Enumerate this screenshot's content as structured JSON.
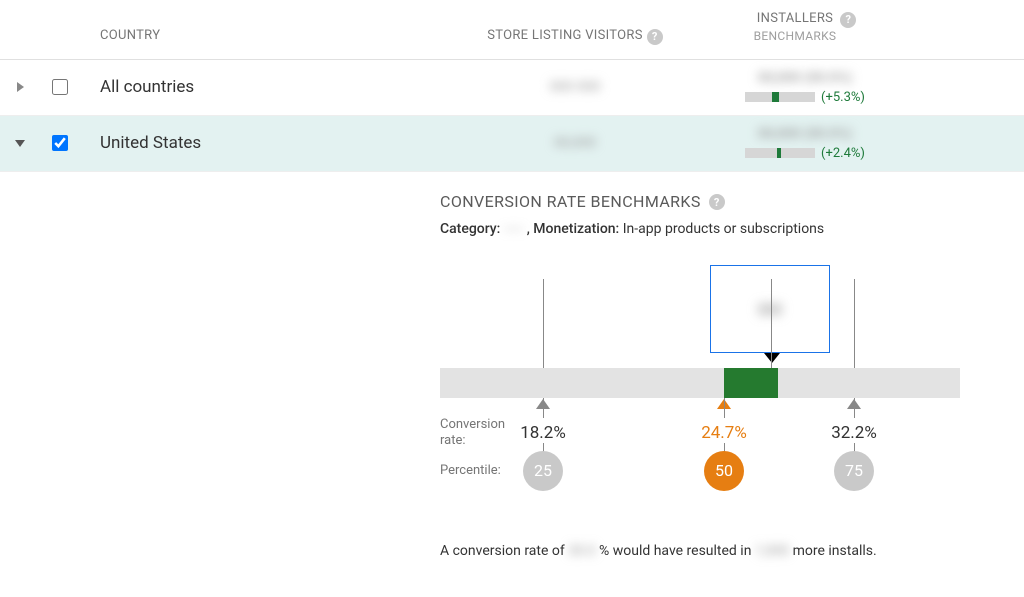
{
  "headers": {
    "country": "COUNTRY",
    "visitors": "STORE LISTING VISITORS",
    "installers": "INSTALLERS",
    "benchmarks": "BENCHMARKS",
    "help": "?"
  },
  "rows": [
    {
      "expanded": false,
      "checked": false,
      "country": "All countries",
      "visitors_blur": "000 000",
      "installers_blur": "00,000 (00.0%)",
      "delta": "(+5.3%)",
      "bar_left_pct": 38,
      "bar_width_pct": 10
    },
    {
      "expanded": true,
      "checked": true,
      "country": "United States",
      "visitors_blur": "00,000",
      "installers_blur": "00,000 (00.0%)",
      "delta": "(+2.4%)",
      "bar_left_pct": 46,
      "bar_width_pct": 5
    }
  ],
  "benchmarks": {
    "title": "CONVERSION RATE BENCHMARKS",
    "help": "?",
    "category_label": "Category:",
    "category_value_blur": "-----",
    "monetization_label": ", Monetization:",
    "monetization_value": " In-app products or subscriptions",
    "rate_label": "Conversion rate:",
    "percentile_label": "Percentile:",
    "rates": {
      "p25": "18.2%",
      "p50": "24.7%",
      "p75": "32.2%"
    },
    "percentiles": {
      "p25": "25",
      "p50": "50",
      "p75": "75"
    },
    "footer_a": "A conversion rate of ",
    "footer_blur1": "30.0",
    "footer_b": "% would have resulted in ",
    "footer_blur2": "1,000",
    "footer_c": " more installs.",
    "tooltip_blur": "●●"
  },
  "chart_data": {
    "type": "bar",
    "title": "Conversion Rate Benchmarks",
    "xlabel": "Percentile",
    "ylabel": "Conversion rate (%)",
    "categories": [
      "25",
      "50",
      "75"
    ],
    "values": [
      18.2,
      24.7,
      32.2
    ],
    "highlight_index": 1,
    "user_value_estimate": 27,
    "ylim": [
      0,
      40
    ]
  }
}
